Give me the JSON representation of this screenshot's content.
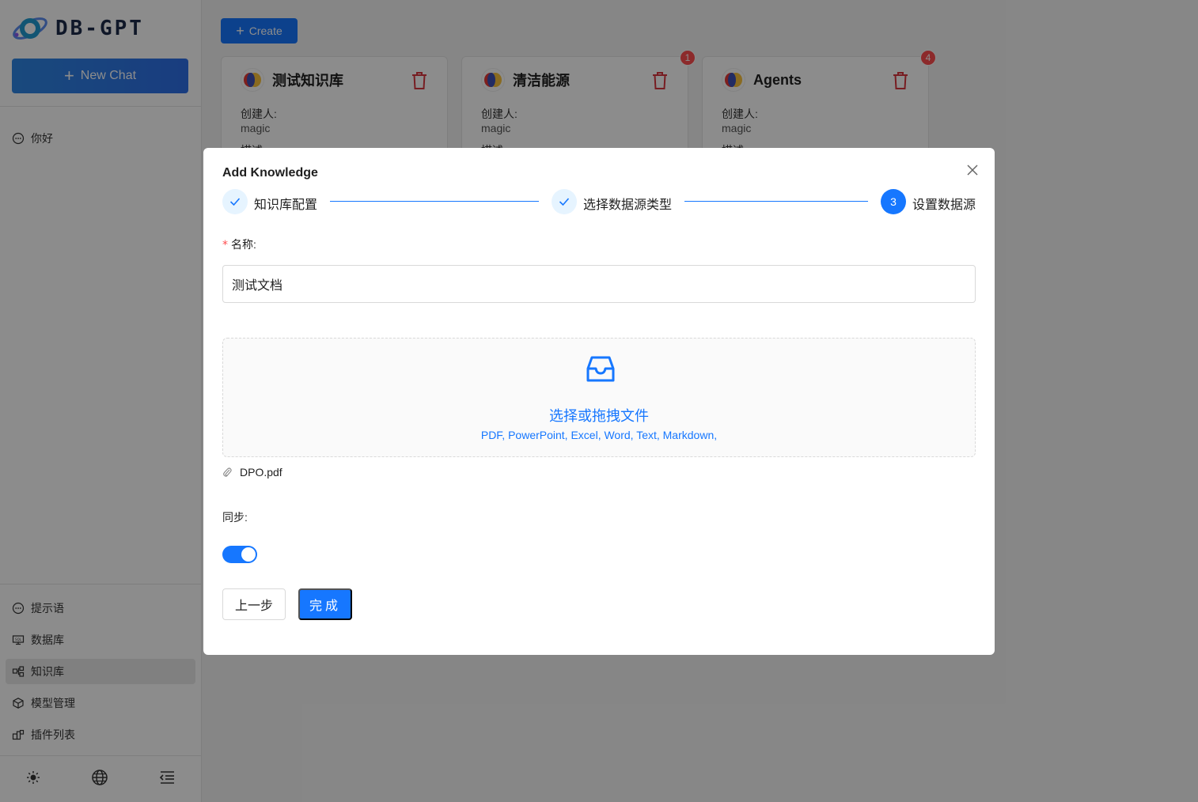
{
  "app": {
    "logo_text": "DB-GPT"
  },
  "sidebar": {
    "new_chat_label": "New Chat",
    "chats": [
      {
        "label": "你好"
      }
    ],
    "menu": [
      {
        "label": "提示语",
        "icon": "message-icon"
      },
      {
        "label": "数据库",
        "icon": "database-icon"
      },
      {
        "label": "知识库",
        "icon": "knowledge-icon",
        "active": true
      },
      {
        "label": "模型管理",
        "icon": "model-icon"
      },
      {
        "label": "插件列表",
        "icon": "plugin-icon"
      }
    ],
    "bottom_icons": [
      "theme-sun-icon",
      "language-globe-icon",
      "collapse-menu-icon"
    ]
  },
  "main": {
    "create_label": "Create",
    "cards": [
      {
        "title": "测试知识库",
        "creator_label": "创建人:",
        "creator": "magic",
        "desc_label": "描述",
        "badge": ""
      },
      {
        "title": "清洁能源",
        "creator_label": "创建人:",
        "creator": "magic",
        "desc_label": "描述",
        "badge": "1"
      },
      {
        "title": "Agents",
        "creator_label": "创建人:",
        "creator": "magic",
        "desc_label": "描述",
        "badge": "4"
      }
    ]
  },
  "modal": {
    "title": "Add Knowledge",
    "steps": [
      {
        "label": "知识库配置",
        "status": "finished"
      },
      {
        "label": "选择数据源类型",
        "status": "finished"
      },
      {
        "label": "设置数据源",
        "status": "current",
        "number": "3"
      }
    ],
    "name_label": "名称:",
    "name_value": "测试文档",
    "upload_text": "选择或拖拽文件",
    "upload_hint": "PDF, PowerPoint, Excel, Word, Text, Markdown,",
    "file_name": "DPO.pdf",
    "sync_label": "同步:",
    "sync_on": true,
    "prev_label": "上一步",
    "done_label": "完成"
  },
  "colors": {
    "primary": "#1677ff",
    "danger": "#ff4d4f",
    "overlay": "rgba(0,0,0,0.45)"
  }
}
